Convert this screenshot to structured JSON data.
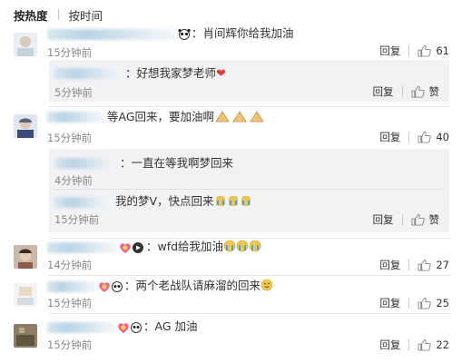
{
  "sort_tabs": {
    "hot": "按热度",
    "time": "按时间"
  },
  "reply_label": "回复",
  "comments": [
    {
      "text": "：肖间辉你给我加油",
      "time": "15分钟前",
      "likes": "61",
      "replies": [
        {
          "text": "：好想我家梦老师",
          "time": "5分钟前",
          "likes": "赞"
        }
      ]
    },
    {
      "text": "等AG回来，要加油啊",
      "time": "15分钟前",
      "likes": "40",
      "replies": [
        {
          "text": "：一直在等我啊梦回来",
          "time": "4分钟前",
          "likes": "赞"
        },
        {
          "text": "我的梦V，快点回来",
          "time": "15分钟前",
          "likes": "赞"
        }
      ]
    },
    {
      "text": "：wfd给我加油",
      "time": "14分钟前",
      "likes": "27"
    },
    {
      "text": "：两个老战队请麻溜的回来",
      "time": "15分钟前",
      "likes": "25"
    },
    {
      "text": "：AG 加油",
      "time": "15分钟前",
      "likes": "22"
    }
  ],
  "colors": {
    "accent_heart": "#e4393c",
    "reply_bg": "#f2f2f5",
    "time_gray": "#888888"
  }
}
